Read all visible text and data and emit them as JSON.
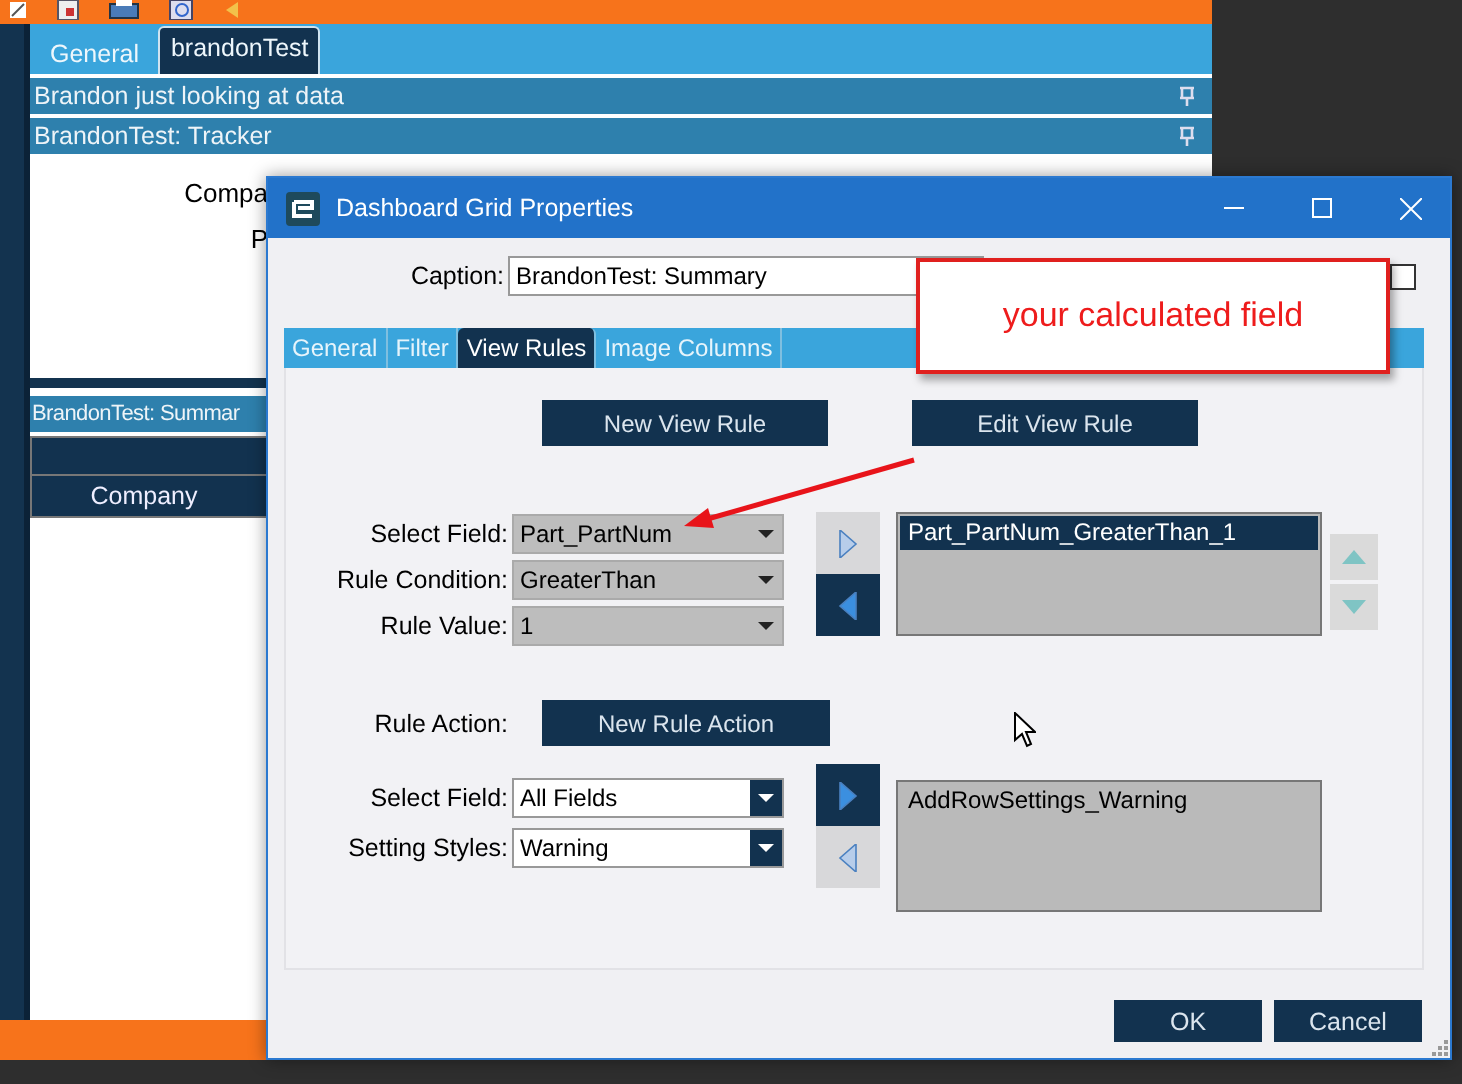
{
  "app": {
    "tabs": [
      {
        "label": "General",
        "selected": false
      },
      {
        "label": "brandonTest",
        "selected": true
      }
    ],
    "panels": [
      {
        "title": "Brandon just looking at data"
      },
      {
        "title": "BrandonTest: Tracker"
      }
    ],
    "tracker_fields": [
      "Compa",
      "P"
    ],
    "summary_panel": {
      "title": "BrandonTest: Summar",
      "columns": [
        "Company"
      ]
    }
  },
  "dialog": {
    "title": "Dashboard Grid Properties",
    "caption": {
      "label": "Caption:",
      "value": "BrandonTest: Summary"
    },
    "checkbox": {
      "checked": false
    },
    "tabs": [
      {
        "label": "General",
        "selected": false
      },
      {
        "label": "Filter",
        "selected": false
      },
      {
        "label": "View Rules",
        "selected": true
      },
      {
        "label": "Image Columns",
        "selected": false
      }
    ],
    "buttons": [
      "New View Rule",
      "Edit View Rule"
    ],
    "rule_fields": [
      {
        "label": "Select Field:",
        "value": "Part_PartNum",
        "disabled": true
      },
      {
        "label": "Rule Condition:",
        "value": "GreaterThan",
        "disabled": true
      },
      {
        "label": "Rule Value:",
        "value": "1",
        "disabled": true
      }
    ],
    "rule_move_buttons": [
      {
        "kind": "right",
        "active": false
      },
      {
        "kind": "left",
        "active": true
      }
    ],
    "rules": [
      {
        "label": "Part_PartNum_GreaterThan_1",
        "selected": true
      }
    ],
    "rule_action": {
      "label": "Rule Action:",
      "button": "New Rule Action"
    },
    "action_fields": [
      {
        "label": "Select Field:",
        "value": "All Fields",
        "disabled": false
      },
      {
        "label": "Setting Styles:",
        "value": "Warning",
        "disabled": false
      }
    ],
    "action_move_buttons": [
      {
        "kind": "right",
        "active": true
      },
      {
        "kind": "left",
        "active": false
      }
    ],
    "actions": [
      {
        "label": "AddRowSettings_Warning",
        "selected": false
      }
    ],
    "footer_buttons": [
      "OK",
      "Cancel"
    ]
  },
  "callout": {
    "text": "your calculated field"
  }
}
